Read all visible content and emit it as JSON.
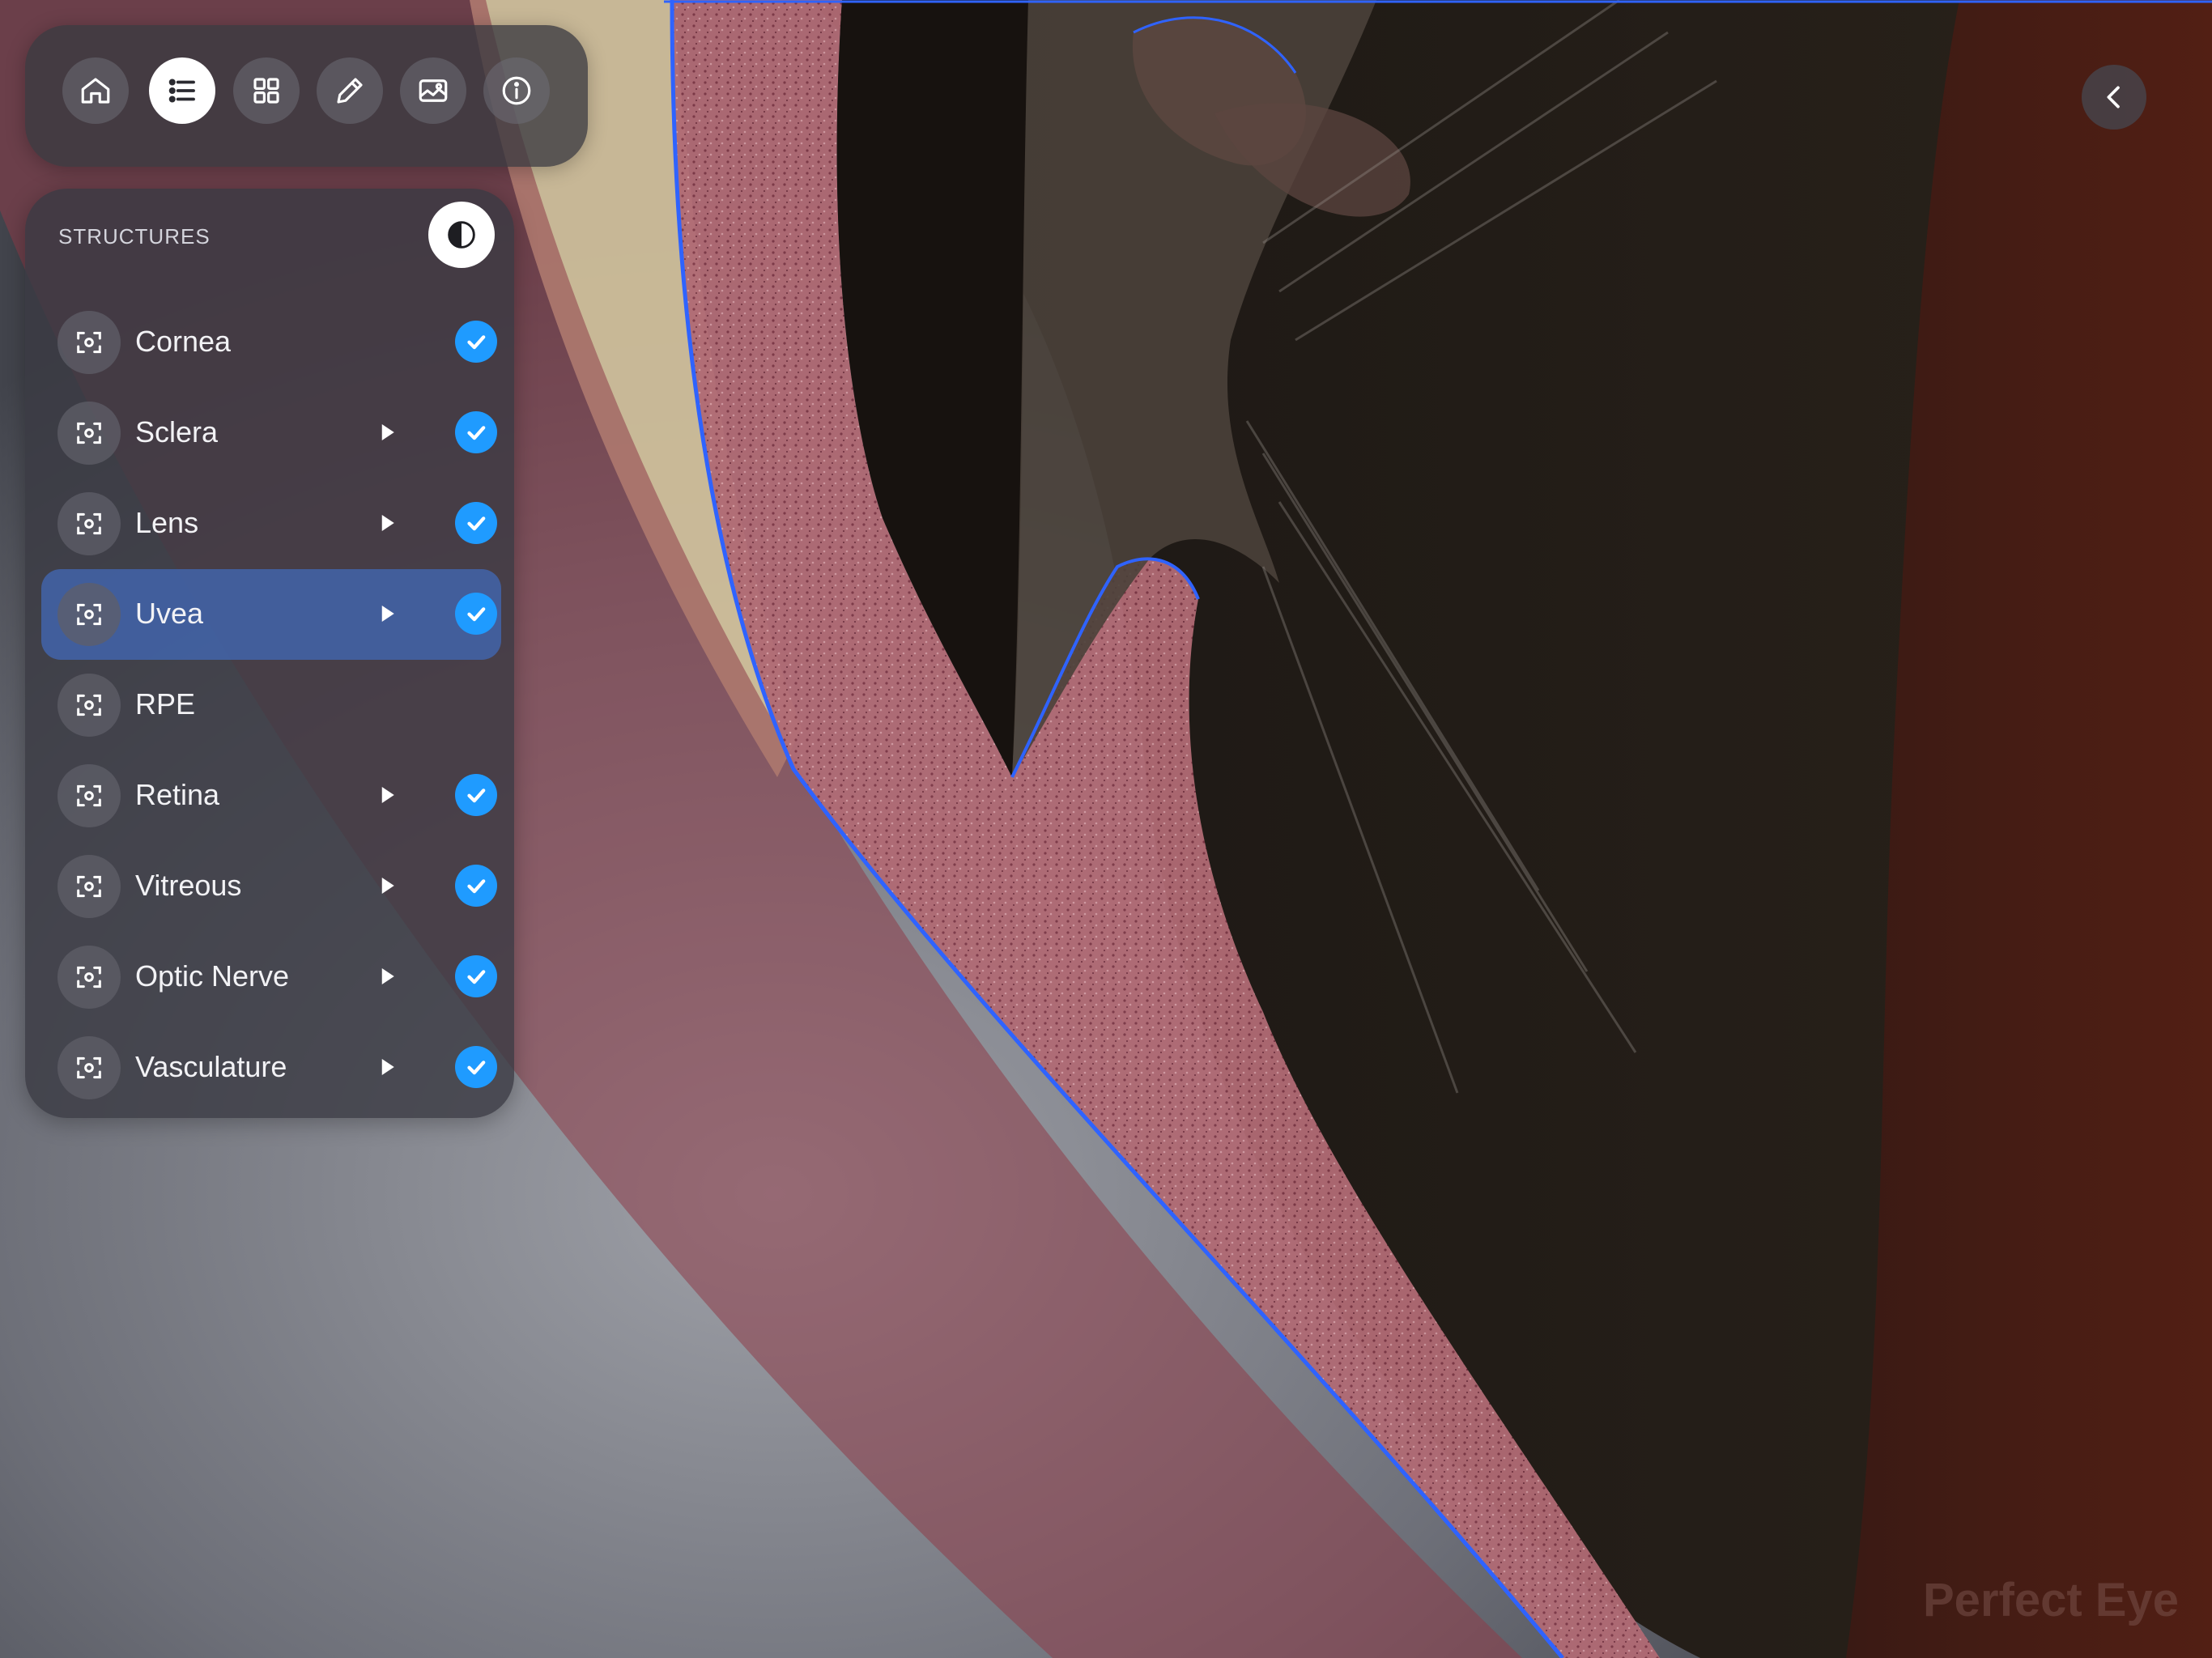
{
  "toolbar": {
    "buttons": [
      {
        "icon": "home-icon"
      },
      {
        "icon": "list-icon",
        "active": true
      },
      {
        "icon": "grid-icon"
      },
      {
        "icon": "pencil-icon"
      },
      {
        "icon": "gallery-icon"
      },
      {
        "icon": "info-icon"
      }
    ]
  },
  "panel": {
    "title": "STRUCTURES",
    "items": [
      {
        "label": "Cornea",
        "expandable": false,
        "checked": true,
        "selected": false
      },
      {
        "label": "Sclera",
        "expandable": true,
        "checked": true,
        "selected": false
      },
      {
        "label": "Lens",
        "expandable": true,
        "checked": true,
        "selected": false
      },
      {
        "label": "Uvea",
        "expandable": true,
        "checked": true,
        "selected": true
      },
      {
        "label": "RPE",
        "expandable": false,
        "checked": false,
        "selected": false
      },
      {
        "label": "Retina",
        "expandable": true,
        "checked": true,
        "selected": false
      },
      {
        "label": "Vitreous",
        "expandable": true,
        "checked": true,
        "selected": false
      },
      {
        "label": "Optic Nerve",
        "expandable": true,
        "checked": true,
        "selected": false
      },
      {
        "label": "Vasculature",
        "expandable": true,
        "checked": true,
        "selected": false
      }
    ]
  },
  "brand": {
    "watermark": "Perfect Eye"
  },
  "colors": {
    "accent": "#1f9bff",
    "selected_row": "#4264aa",
    "outline": "#2f63ff"
  }
}
